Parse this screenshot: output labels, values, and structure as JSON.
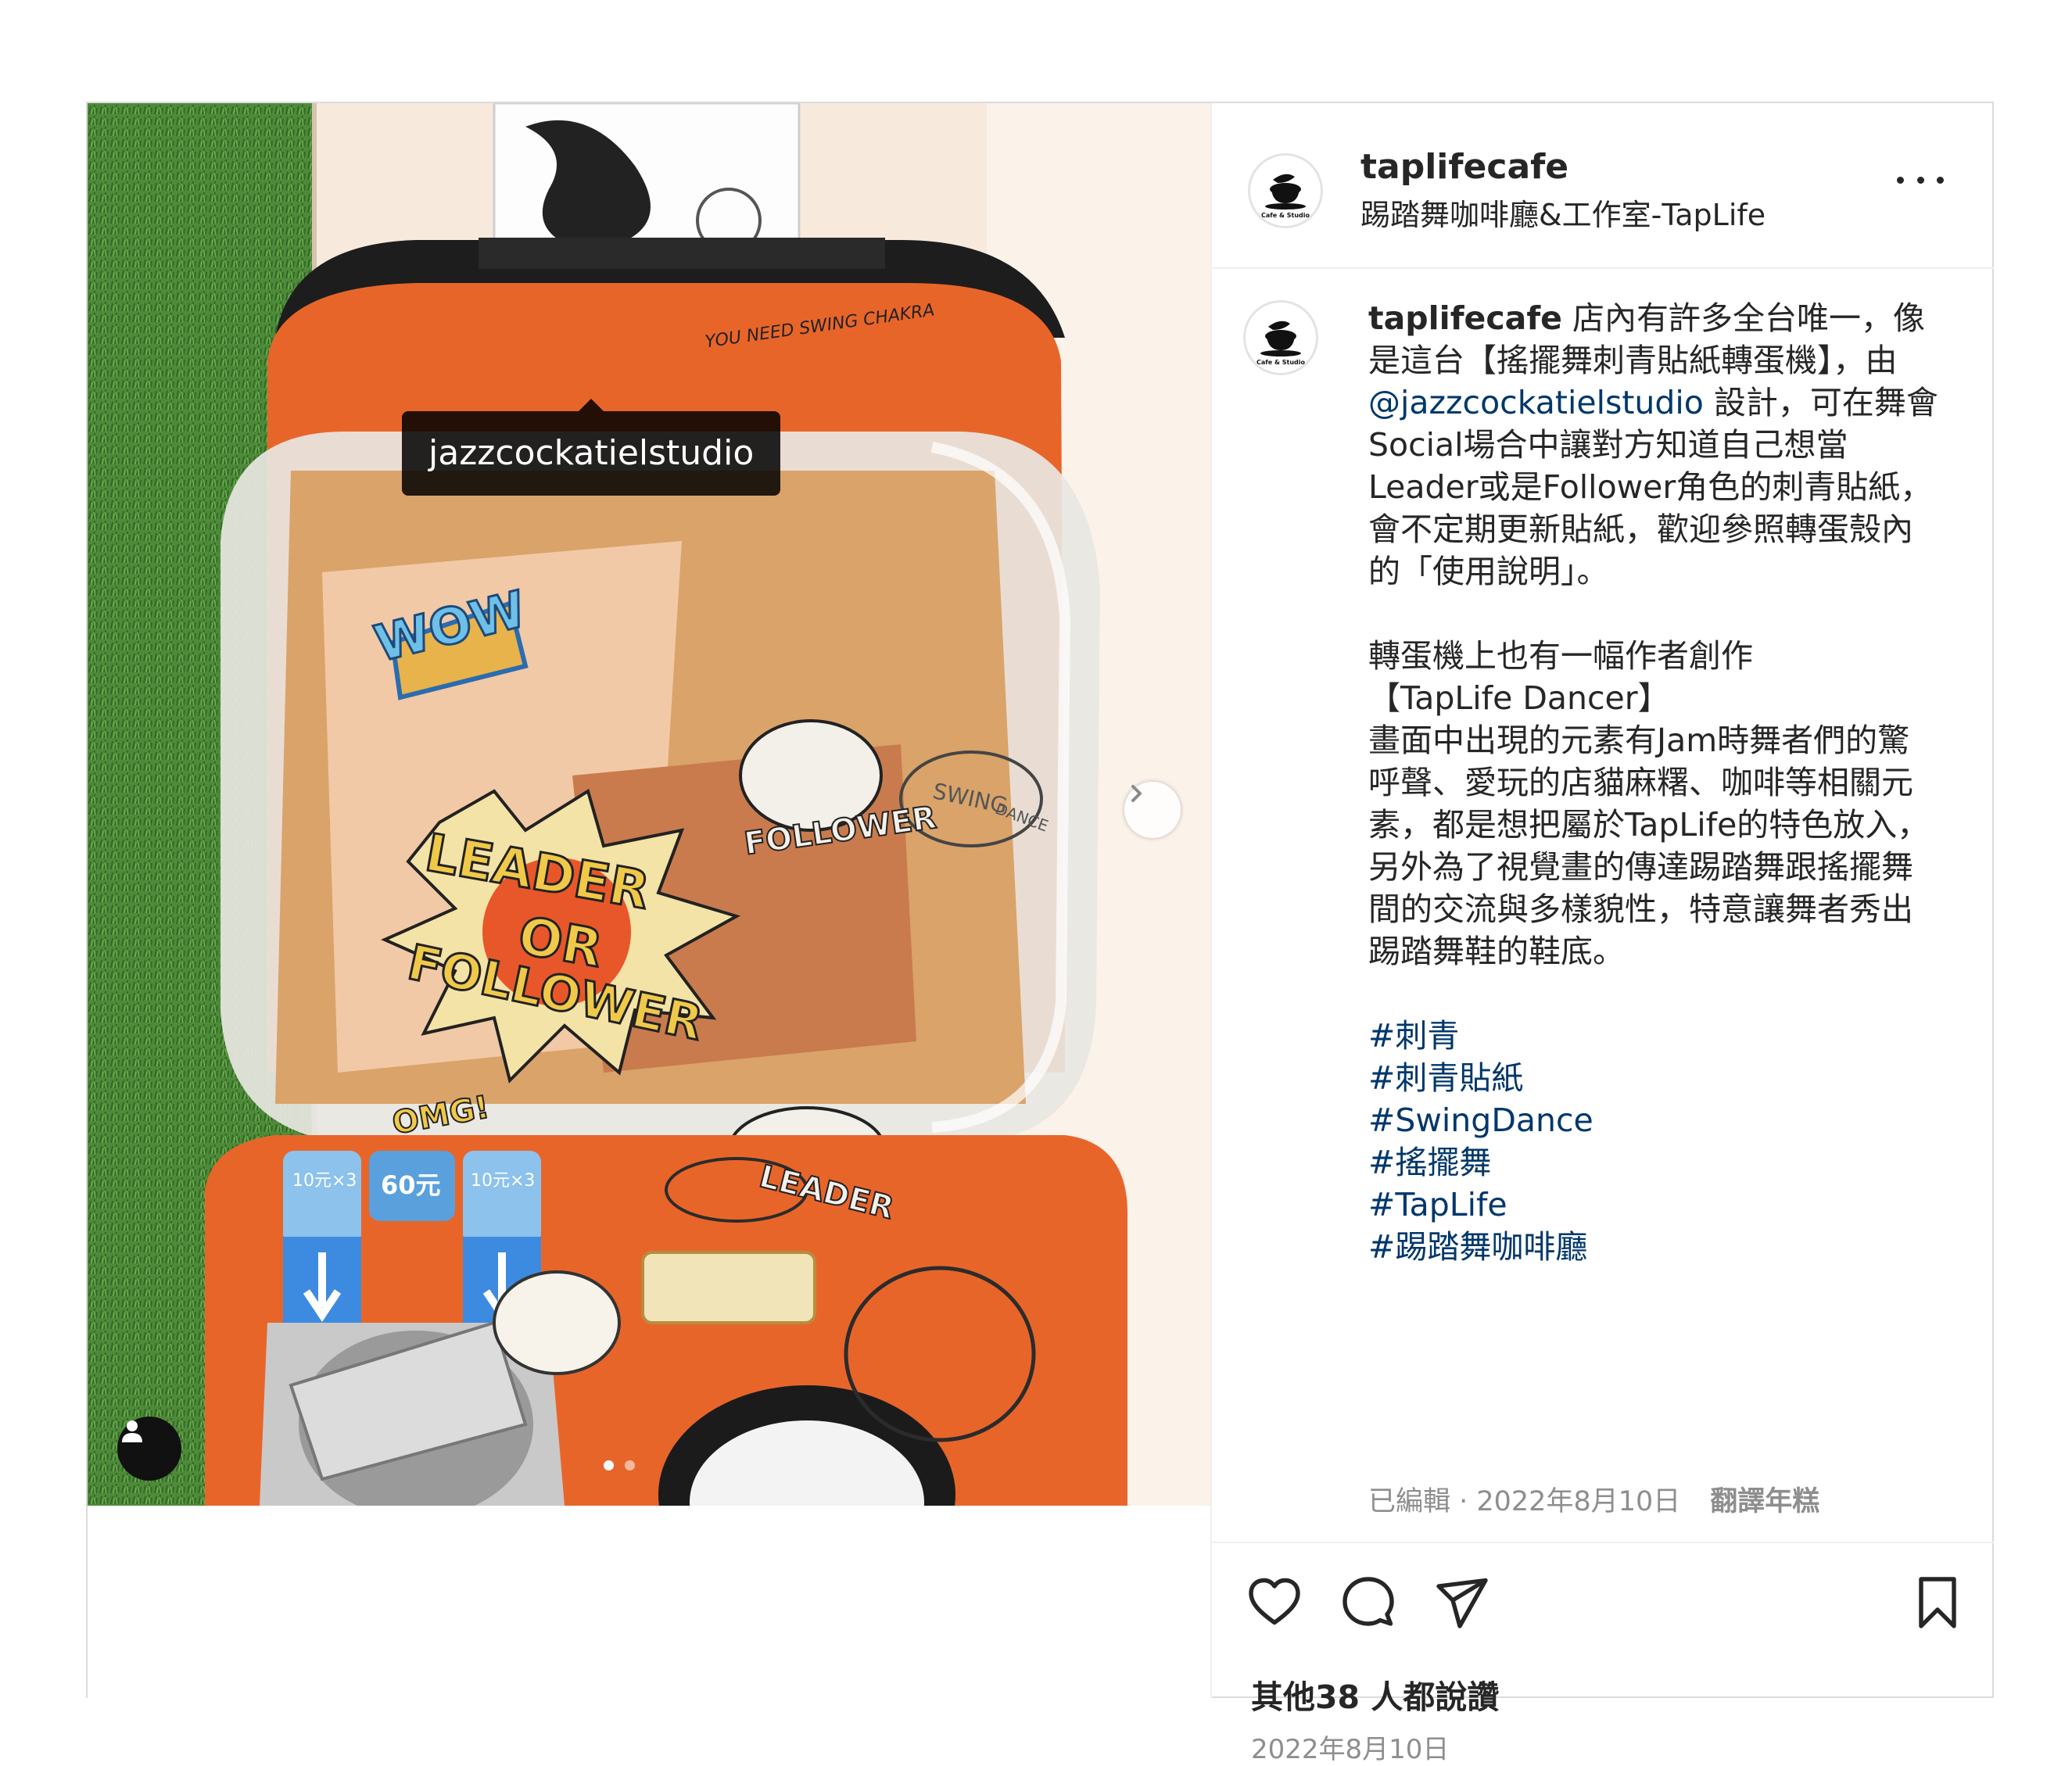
{
  "post": {
    "username": "taplifecafe",
    "subtitle": "踢踏舞咖啡廳&工作室-TapLife",
    "avatar_text": "Cafe & Studio",
    "photo_tag": "jazzcockatielstudio",
    "photo_texts": {
      "wow": "WOW",
      "leader": "LEADER",
      "or": "OR",
      "follower": "FOLLOWER",
      "follower_sticker": "FOLLOWER",
      "leader_sticker": "LEADER",
      "swing": "SWING",
      "dance": "DANCE",
      "chakra": "YOU NEED SWING CHAKRA",
      "omg": "OMG!",
      "coin1": "10元×3",
      "coin2": "60元",
      "coin3": "10元×3"
    },
    "caption": {
      "username": "taplifecafe",
      "p1_before": "店內有許多全台唯一，像是這台【搖擺舞刺青貼紙轉蛋機】，由 ",
      "mention": "@jazzcockatielstudio",
      "p1_after": " 設計，可在舞會Social場合中讓對方知道自己想當Leader或是Follower角色的刺青貼紙，會不定期更新貼紙，歡迎參照轉蛋殼內的「使用說明」。",
      "p2_line1": "轉蛋機上也有一幅作者創作",
      "p2_line2": "【TapLife Dancer】",
      "p2_line3": "畫面中出現的元素有Jam時舞者們的驚呼聲、愛玩的店貓麻糬、咖啡等相關元素，都是想把屬於TapLife的特色放入，另外為了視覺畫的傳達踢踏舞跟搖擺舞間的交流與多樣貌性，特意讓舞者秀出踢踏舞鞋的鞋底。",
      "hashtags": [
        "#刺青",
        "#刺青貼紙",
        "#SwingDance",
        "#搖擺舞",
        "#TapLife",
        "#踢踏舞咖啡廳"
      ]
    },
    "meta": {
      "edited": "已編輯 · 2022年8月10日",
      "translate": "翻譯年糕"
    },
    "likes": {
      "prefix": "其他",
      "count": "38",
      "suffix": " 人都說讚"
    },
    "date": "2022年8月10日",
    "carousel": {
      "current": 1,
      "total": 2
    }
  },
  "icons": {
    "more": "more-options-icon",
    "like": "heart-icon",
    "comment": "comment-icon",
    "share": "send-icon",
    "save": "bookmark-icon",
    "next": "chevron-right-icon",
    "user_tags": "user-icon"
  },
  "colors": {
    "link": "#00376b",
    "secondary": "#8e8e8e",
    "machine_orange": "#e8652a"
  }
}
